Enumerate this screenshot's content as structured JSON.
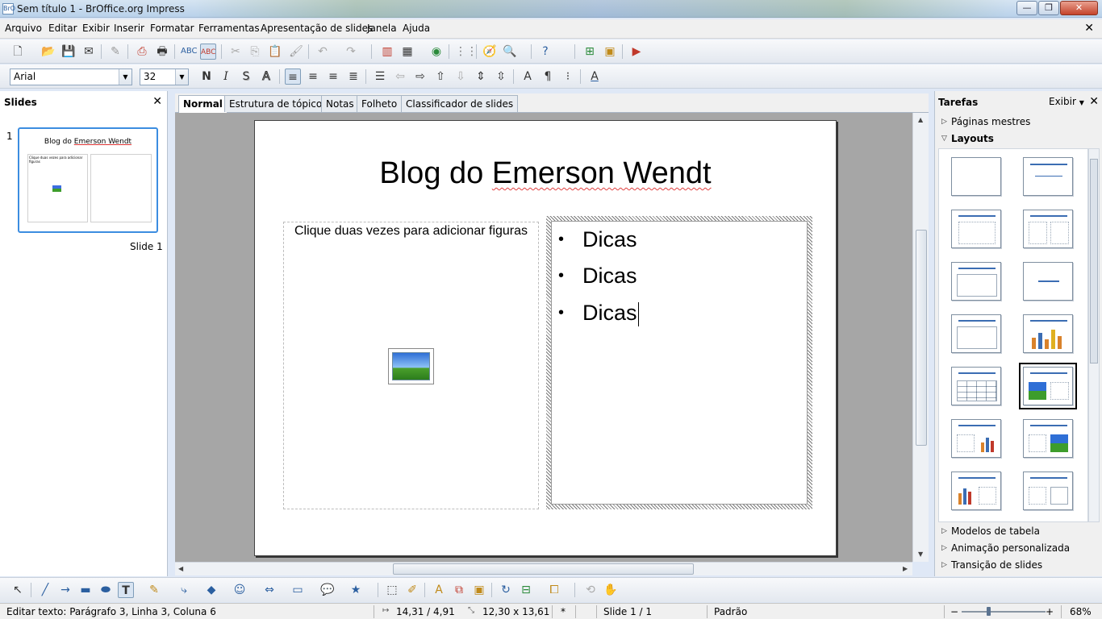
{
  "window": {
    "title": "Sem título 1 - BrOffice.org Impress",
    "app_icon": "BrOffice-impress-icon",
    "controls": {
      "minimize": "—",
      "maximize": "❐",
      "close": "✕"
    }
  },
  "menu": [
    "Arquivo",
    "Editar",
    "Exibir",
    "Inserir",
    "Formatar",
    "Ferramentas",
    "Apresentação de slides",
    "Janela",
    "Ajuda"
  ],
  "menu_close_doc": "✕",
  "formatting": {
    "font_name": "Arial",
    "font_size": "32",
    "bold": "N",
    "italic": "I",
    "shadow": "S",
    "outline": "A"
  },
  "slides_pane": {
    "title": "Slides",
    "close": "✕",
    "slide_number": "1",
    "slide_label": "Slide 1",
    "thumb_title_prefix": "Blog do ",
    "thumb_title_underlined": "Emerson Wendt",
    "thumb_left_caption": "Clique duas vezes para adicionar figuras"
  },
  "view_tabs": [
    "Normal",
    "Estrutura de tópicos",
    "Notas",
    "Folheto",
    "Classificador de slides"
  ],
  "active_tab": "Normal",
  "slide": {
    "title_prefix": "Blog do ",
    "title_underlined": "Emerson Wendt",
    "left_placeholder": "Clique duas vezes para adicionar figuras",
    "bullets": [
      "Dicas",
      "Dicas",
      "Dicas"
    ],
    "bullet_char": "•"
  },
  "tasks_pane": {
    "title": "Tarefas",
    "view_label": "Exibir",
    "close": "✕",
    "sections_top": [
      "Páginas mestres",
      "Layouts"
    ],
    "sections_bottom": [
      "Modelos de tabela",
      "Animação personalizada",
      "Transição de slides"
    ],
    "selected_layout": "title-image-text"
  },
  "status": {
    "edit_text": "Editar texto: Parágrafo 3, Linha 3, Coluna 6",
    "position": "14,31 / 4,91",
    "size": "12,30 x 13,61",
    "modified": "*",
    "slide": "Slide 1 / 1",
    "master": "Padrão",
    "zoom_minus": "−",
    "zoom_plus": "+",
    "zoom": "68%"
  },
  "colors": {
    "accent": "#3c8de0",
    "titlebar": "#c9dcf0",
    "spellcheck": "#e04040"
  }
}
